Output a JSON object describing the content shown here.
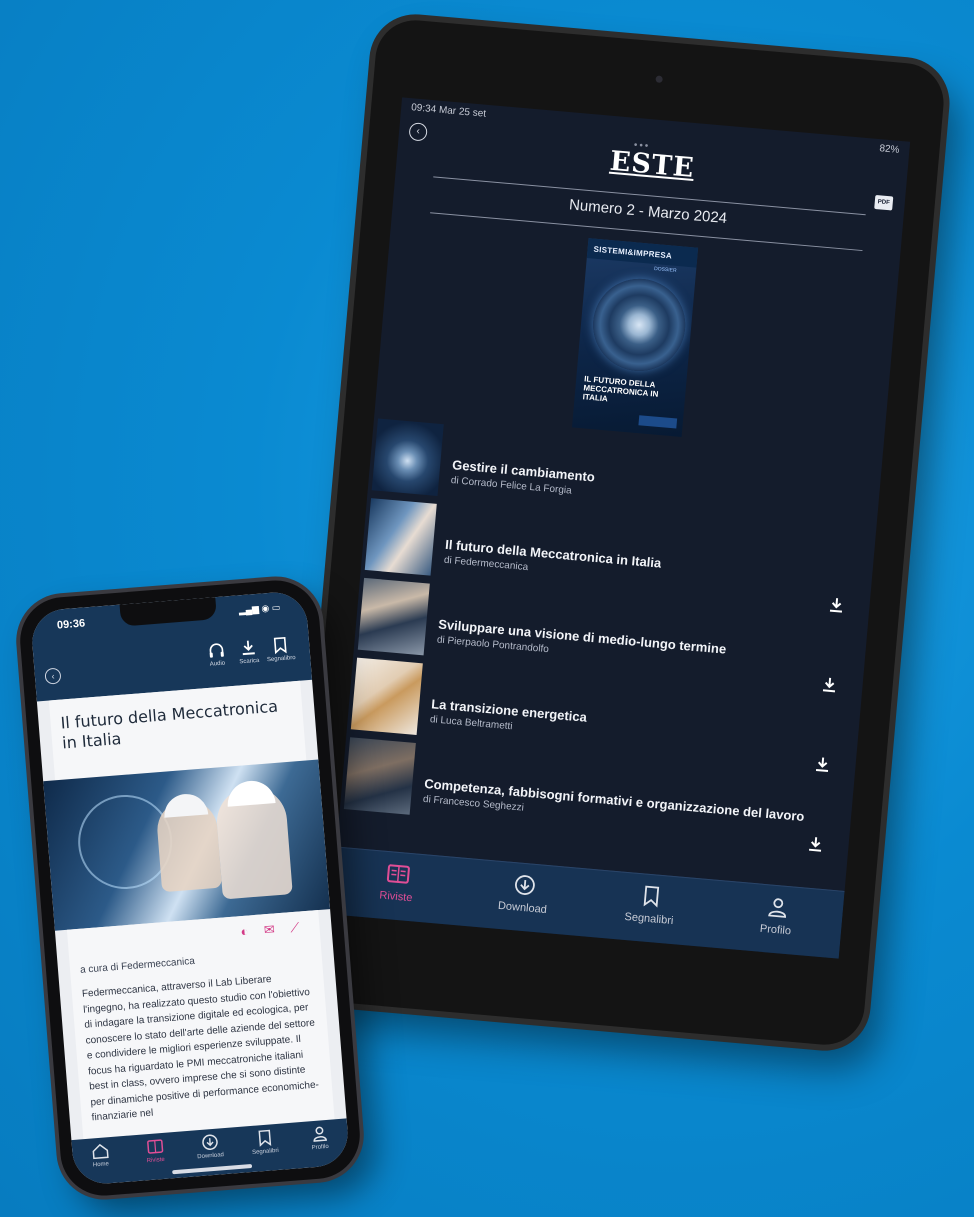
{
  "colors": {
    "background": "#0a8ad1",
    "app_dark": "#141c2c",
    "app_navy": "#173759",
    "accent_pink": "#e04e96"
  },
  "tablet": {
    "status_time": "09:34  Mar 25 set",
    "status_right": "82%",
    "dots": "•••",
    "logo": "ESTE",
    "cover_icon": "PDF",
    "issue": "Numero 2 - Marzo 2024",
    "cover": {
      "magazine": "SISTEMI&IMPRESA",
      "tag": "DOSSIER",
      "heading": "IL FUTURO DELLA MECCATRONICA IN ITALIA"
    },
    "articles": [
      {
        "title": "Gestire il cambiamento",
        "author": "di Corrado Felice La Forgia"
      },
      {
        "title": "Il futuro della Meccatronica in Italia",
        "author": "di Federmeccanica"
      },
      {
        "title": "Sviluppare una visione di medio-lungo termine",
        "author": "di Pierpaolo Pontrandolfo"
      },
      {
        "title": "La transizione energetica",
        "author": "di Luca Beltrametti"
      },
      {
        "title": "Competenza, fabbisogni formativi e organizzazione del lavoro",
        "author": "di Francesco Seghezzi"
      }
    ],
    "tabs": [
      {
        "label": "Riviste",
        "icon": "magazine-icon"
      },
      {
        "label": "Download",
        "icon": "download-icon"
      },
      {
        "label": "Segnalibri",
        "icon": "bookmark-icon"
      },
      {
        "label": "Profilo",
        "icon": "profile-icon"
      }
    ]
  },
  "phone": {
    "time": "09:36",
    "actions": [
      {
        "label": "Audio",
        "icon": "headphones-icon"
      },
      {
        "label": "Scarica",
        "icon": "download-icon"
      },
      {
        "label": "Segnalibro",
        "icon": "bookmark-icon"
      }
    ],
    "article_title": "Il futuro della Meccatronica in Italia",
    "share_icons": "◐ ✉ ⟋",
    "curator": "a cura di Federmeccanica",
    "body": "Federmeccanica, attraverso il Lab Liberare l'ingegno, ha realizzato questo studio con l'obiettivo di indagare la transizione digitale ed ecologica, per conoscere lo stato dell'arte delle aziende del settore e condividere le migliori esperienze sviluppate. Il focus ha riguardato le PMI meccatroniche italiani best in class, ovvero imprese che si sono distinte per dinamiche positive di performance economiche-finanziarie nel",
    "tabs": [
      {
        "label": "Home",
        "icon": "home-icon"
      },
      {
        "label": "Riviste",
        "icon": "magazine-icon"
      },
      {
        "label": "Download",
        "icon": "download-icon"
      },
      {
        "label": "Segnalibri",
        "icon": "bookmark-icon"
      },
      {
        "label": "Profilo",
        "icon": "profile-icon"
      }
    ]
  }
}
